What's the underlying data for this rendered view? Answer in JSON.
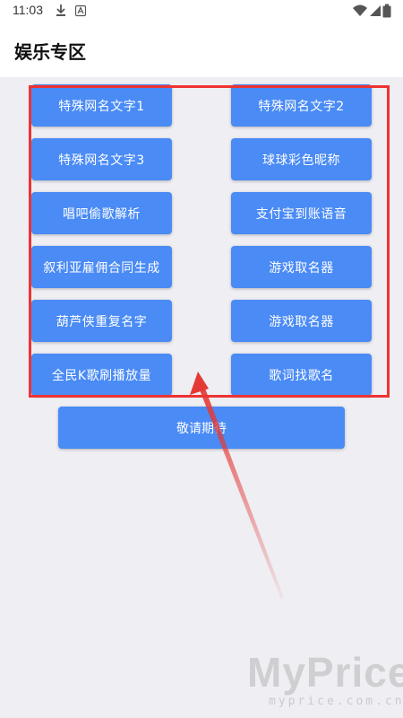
{
  "status_bar": {
    "time": "11:03",
    "icons": [
      "download-icon",
      "a-icon",
      "wifi-icon",
      "signal-icon",
      "battery-icon"
    ]
  },
  "app_bar": {
    "title": "娱乐专区"
  },
  "grid_buttons": [
    {
      "label": "特殊网名文字1"
    },
    {
      "label": "特殊网名文字2"
    },
    {
      "label": "特殊网名文字3"
    },
    {
      "label": "球球彩色昵称"
    },
    {
      "label": "唱吧偷歌解析"
    },
    {
      "label": "支付宝到账语音"
    },
    {
      "label": "叙利亚雇佣合同生成"
    },
    {
      "label": "游戏取名器"
    },
    {
      "label": "葫芦侠重复名字"
    },
    {
      "label": "游戏取名器"
    },
    {
      "label": "全民K歌刷播放量"
    },
    {
      "label": "歌词找歌名"
    }
  ],
  "wide_button": {
    "label": "敬请期待"
  },
  "annotation": {
    "frame_color": "#ee3333",
    "arrow_color": "#e53935"
  },
  "watermark": {
    "main": "MyPrice",
    "sub": "myprice.com.cn"
  },
  "colors": {
    "button_blue": "#4a8bf5",
    "background": "#eeeef3"
  }
}
